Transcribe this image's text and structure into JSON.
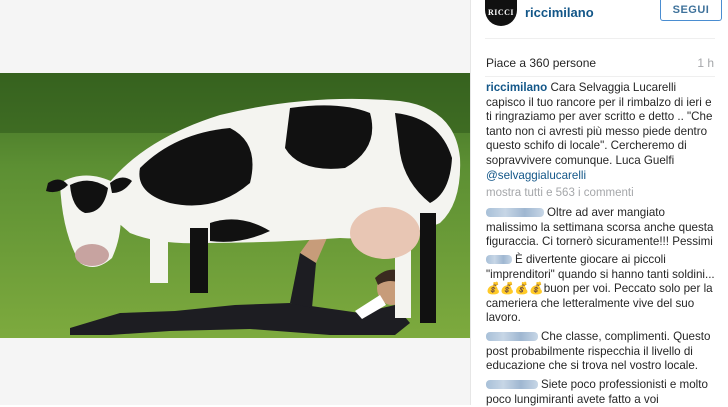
{
  "account": {
    "username": "riccimilano",
    "avatar_text": "RICCI",
    "follow_label": "SEGUI"
  },
  "post": {
    "likes": "Piace a 360 persone",
    "time": "1 h",
    "caption_user": "riccimilano",
    "caption_text": " Cara Selvaggia Lucarelli capisco il tuo rancore per il rimbalzo di ieri e ti ringraziamo per aver scritto e detto .. \"Che tanto non ci avresti più messo piede dentro questo schifo di locale\". Cercheremo di sopravvivere comunque. Luca Guelfi ",
    "caption_mention": "@selvaggialucarelli",
    "view_all": "mostra tutti e 563 i commenti"
  },
  "comments": [
    {
      "text": "Oltre ad aver mangiato malissimo la settimana scorsa anche questa figuraccia. Ci tornerò sicuramente!!! Pessimi"
    },
    {
      "text": "È divertente giocare ai piccoli \"imprenditori\" quando si hanno tanti soldini...💰💰💰💰buon per voi. Peccato solo per la cameriera che letteralmente vive del suo lavoro."
    },
    {
      "text": "Che classe, complimenti. Questo post probabilmente rispecchia il livello di educazione che si trova nel vostro locale."
    },
    {
      "text": "Siete poco professionisti e molto poco lungimiranti avete fatto a voi"
    }
  ],
  "colors": {
    "link": "#125688",
    "follow_border": "#4a8dd1",
    "muted": "#a5a7aa"
  },
  "icons": {
    "money_bag": "money-bag-icon"
  }
}
